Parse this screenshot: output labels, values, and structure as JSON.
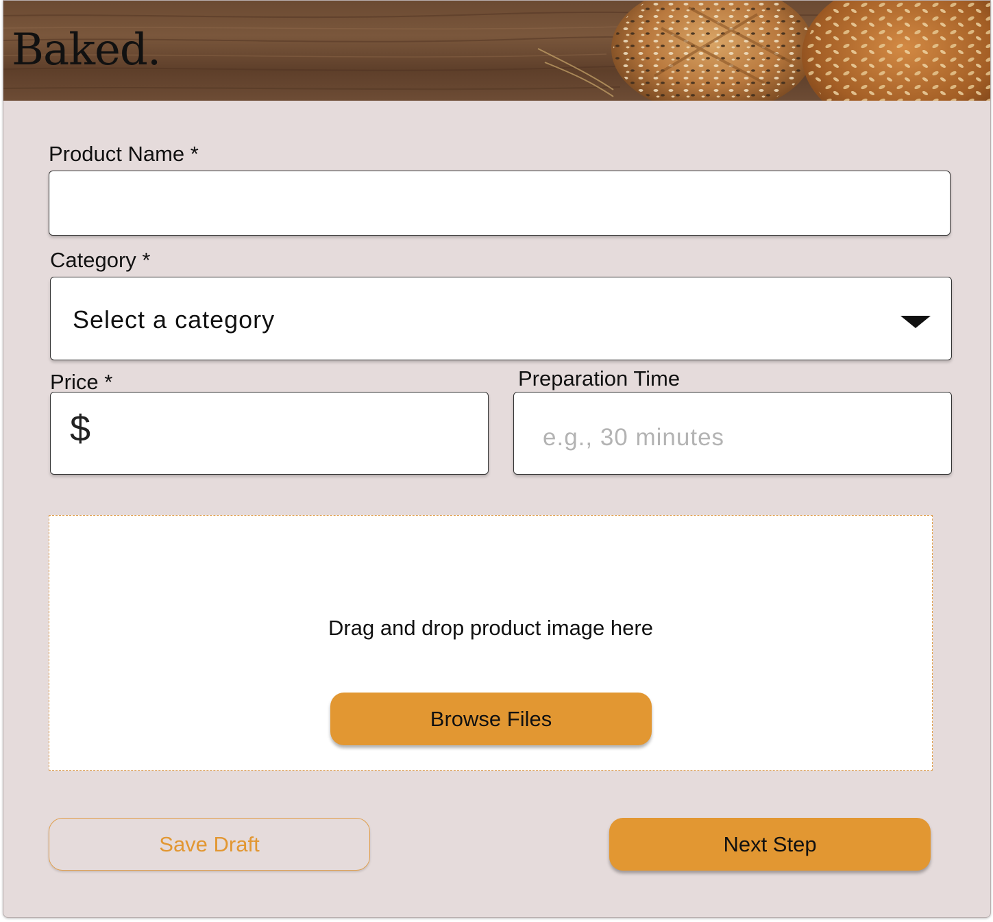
{
  "app": {
    "brand": "Baked."
  },
  "form": {
    "product_name": {
      "label": "Product Name *",
      "value": ""
    },
    "category": {
      "label": "Category *",
      "selected": "Select a category"
    },
    "price": {
      "label": "Price *",
      "currency_symbol": "$",
      "value": ""
    },
    "prep_time": {
      "label": "Preparation Time",
      "placeholder": "e.g., 30 minutes",
      "value": ""
    },
    "image_upload": {
      "prompt": "Drag and drop product image here",
      "browse_label": "Browse Files"
    }
  },
  "actions": {
    "save_draft_label": "Save Draft",
    "next_step_label": "Next Step"
  },
  "icons": {
    "category_dropdown": "chevron-down-icon",
    "price_prefix": "dollar-icon"
  },
  "colors": {
    "accent": "#e29732",
    "background": "#e5dbdb",
    "field_bg": "#ffffff"
  }
}
